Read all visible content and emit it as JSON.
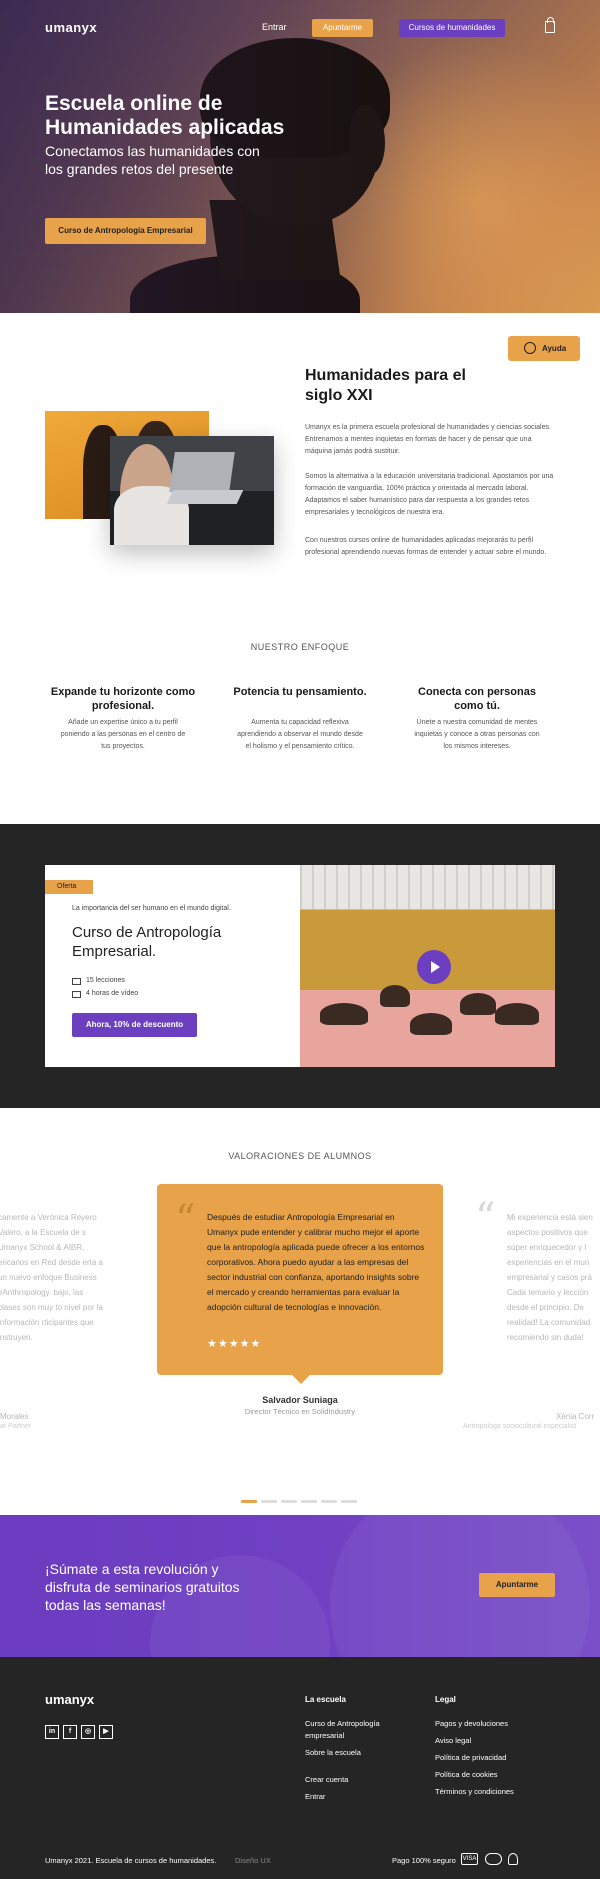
{
  "colors": {
    "accent": "#e8a24a",
    "brand": "#6b3fbf",
    "dark": "#252525"
  },
  "nav": {
    "logo": "umanyx",
    "entrar": "Entrar",
    "apuntarme": "Apuntarme",
    "cursos": "Cursos de humanidades",
    "cart_icon": "shopping-bag-icon"
  },
  "hero": {
    "title": "Escuela online de Humanidades aplicadas",
    "subtitle": "Conectamos las humanidades con los grandes retos del presente",
    "cta": "Curso de Antropología Empresarial"
  },
  "ayuda": {
    "label": "Ayuda",
    "icon": "whatsapp-icon"
  },
  "intro": {
    "title": "Humanidades para el siglo XXI",
    "paragraphs": [
      "Umanyx es la primera escuela profesional de humanidades y ciencias sociales. Entrenamos a mentes inquietas en formas de hacer y de pensar que una máquina jamás podrá sustituir.",
      "Somos la alternativa a la educación universitaria tradicional. Apostamos por una formación de vanguardia, 100% práctica y orientada al mercado laboral. Adaptamos el saber humanístico para dar respuesta a los grandes retos empresariales y tecnológicos de nuestra era.",
      "Con nuestros cursos online de humanidades aplicadas mejorarás tu perfil profesional aprendiendo nuevas formas de entender y actuar sobre el mundo."
    ]
  },
  "enfoque": {
    "heading": "NUESTRO ENFOQUE",
    "columns": [
      {
        "title": "Expande tu horizonte como profesional.",
        "text": "Añade un expertise único a tu perfil poniendo a las personas en el centro de tus proyectos."
      },
      {
        "title": "Potencia tu pensamiento.",
        "text": "Aumenta tu capacidad reflexiva aprendiendo a observar el mundo desde el holismo y el pensamiento crítico."
      },
      {
        "title": "Conecta con personas como tú.",
        "text": "Únete a nuestra comunidad de mentes inquietas y conoce a otras personas con los mismos intereses."
      }
    ]
  },
  "offer": {
    "tag": "Oferta",
    "kicker": "La importancia del ser humano en el mundo digital.",
    "title": "Curso de Antropología Empresarial.",
    "lessons": "15 lecciones",
    "video": "4 horas de vídeo",
    "button": "Ahora, 10% de descuento",
    "play_icon": "play-icon"
  },
  "testimonials": {
    "heading": "VALORACIONES DE ALUMNOS",
    "left_text": "camente a Verónica Reyero Valero, a la Escuela de s Umanyx School & AIBR, ericanos en Red desde erta a un nuevo enfoque Business #Anthropology. bajo, las clases son muy to nivel por la información rticipantes que instruyen.",
    "left_name": "Morales",
    "left_role": "ar Partner",
    "main_text": "Después de estudiar Antropología Empresarial en Umanyx pude entender y calibrar mucho mejor el aporte que la antropología aplicada puede ofrecer a los entornos corporativos. Ahora puedo ayudar a las empresas del sector industrial con confianza, aportando insights sobre el mercado y creando herramientas para evaluar la adopción cultural de tecnologías e innovación.",
    "stars": "★★★★★",
    "main_name": "Salvador Suniaga",
    "main_role": "Director Técnico en SolidIndustry",
    "right_text": "Mi experiencia está sien aspectos positivos que súper enriquecedor y l experiencias en el mun empresarial y casos prá Cada temario y lección desde el principio. De realidad! La comunidad recomiendo sin duda!",
    "right_name": "Xènia Corr",
    "right_role": "Antropóloga sociocultural especialist"
  },
  "cta": {
    "text": "¡Súmate a esta revolución y disfruta de seminarios gratuitos todas las semanas!",
    "button": "Apuntarme"
  },
  "footer": {
    "logo": "umanyx",
    "social": [
      "in",
      "f",
      "◎",
      "▶"
    ],
    "escuela_heading": "La escuela",
    "escuela_links": [
      "Curso de Antropología empresarial",
      "Sobre la escuela",
      "Crear cuenta",
      "Entrar"
    ],
    "legal_heading": "Legal",
    "legal_links": [
      "Pagos y devoluciones",
      "Aviso legal",
      "Política de privacidad",
      "Política de cookies",
      "Términos y condiciones"
    ],
    "copyright": "Umanyx 2021. Escuela de cursos de humanidades.",
    "design": "Diseño UX",
    "payment": "Pago 100% seguro",
    "payment_icons": [
      "VISA",
      "mastercard-icon",
      "paypal-icon"
    ]
  }
}
